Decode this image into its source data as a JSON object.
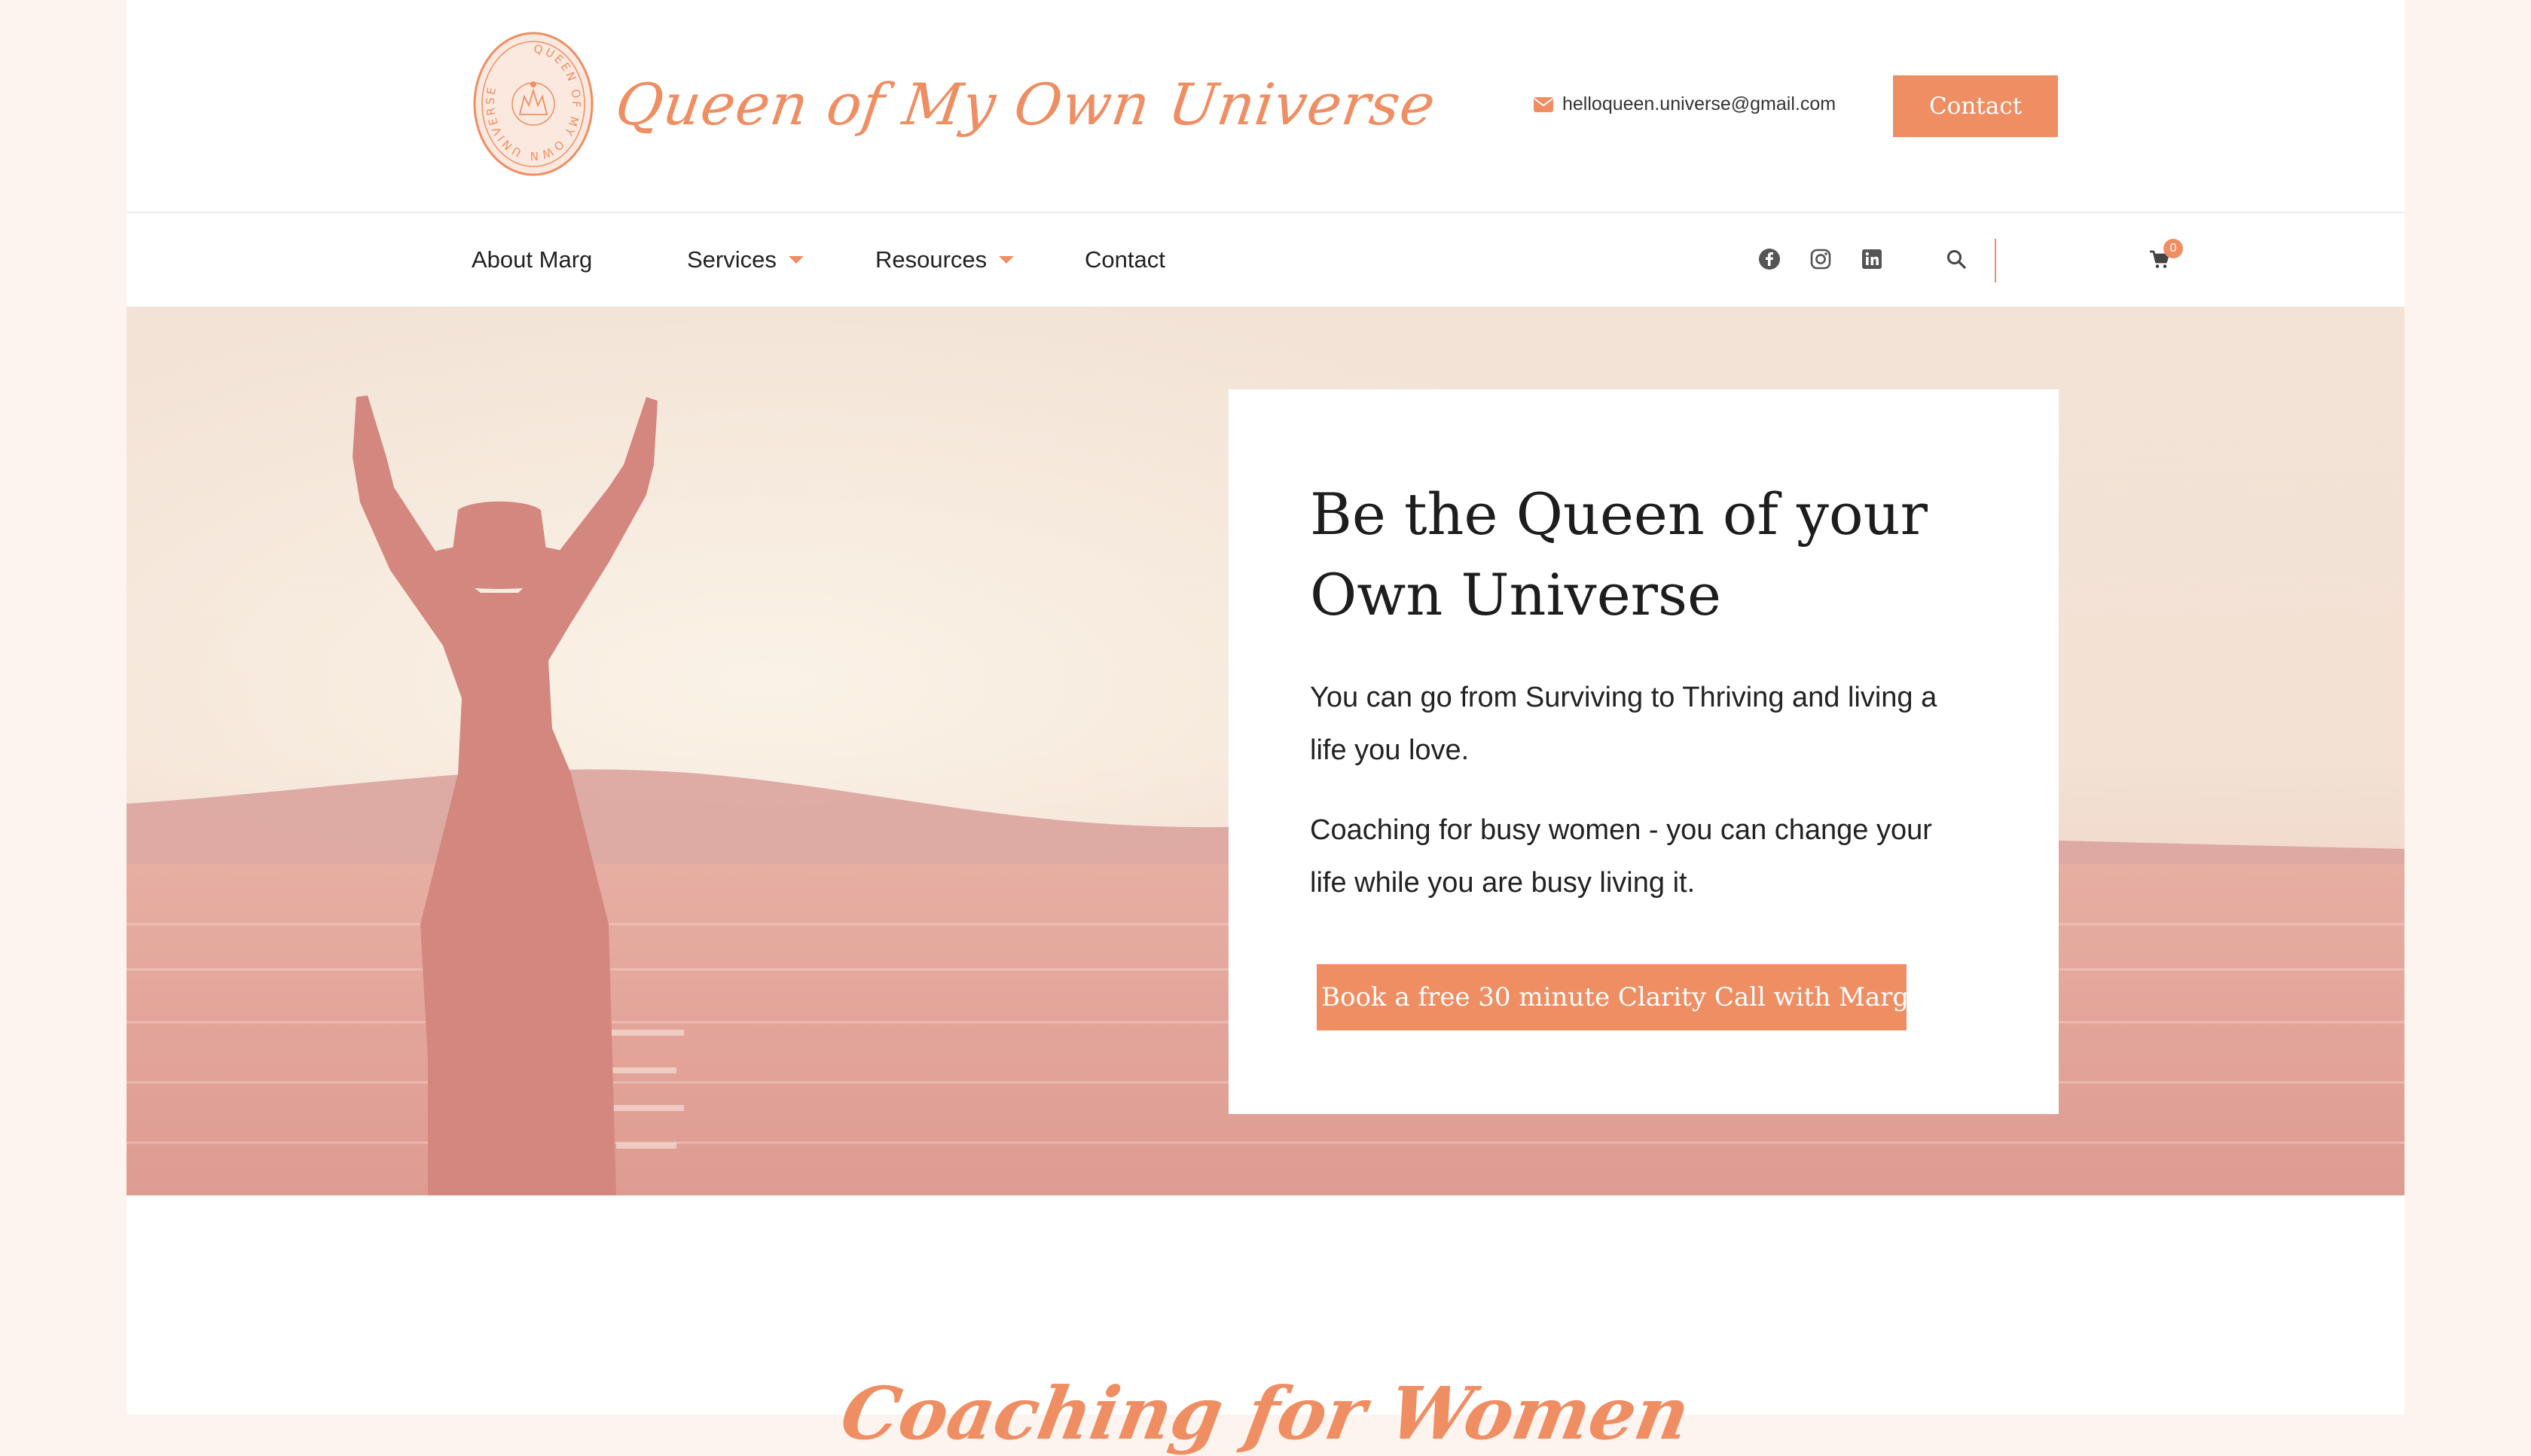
{
  "brand": {
    "name": "Queen of My Own Universe",
    "seal_text": "QUEEN OF MY OWN UNIVERSE",
    "accent_color": "#ef8e63"
  },
  "header": {
    "email": "helloqueen.universe@gmail.com",
    "email_icon": "envelope-icon",
    "contact_label": "Contact"
  },
  "nav": {
    "items": [
      {
        "label": "About Marg",
        "has_dropdown": false
      },
      {
        "label": "Services",
        "has_dropdown": true
      },
      {
        "label": "Resources",
        "has_dropdown": true
      },
      {
        "label": "Contact",
        "has_dropdown": false
      }
    ],
    "social_icons": [
      "facebook-icon",
      "instagram-icon",
      "linkedin-icon"
    ],
    "search_icon": "search-icon",
    "cart_icon": "cart-icon",
    "cart_count": "0"
  },
  "hero": {
    "title": "Be the Queen of your Own Universe",
    "paragraph_1": "You can go from Surviving to Thriving and living a life you love.",
    "paragraph_2": "Coaching for busy women - you can change your life while you are busy living it.",
    "cta_label": "Book a free 30 minute Clarity Call with Marg"
  },
  "section": {
    "heading": "Coaching for Women"
  }
}
